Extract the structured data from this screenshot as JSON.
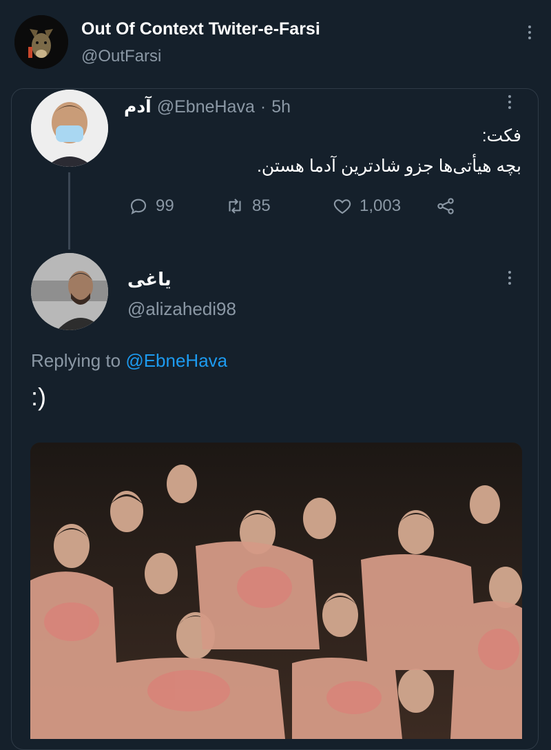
{
  "account": {
    "name": "Out Of Context Twiter-e-Farsi",
    "handle": "@OutFarsi"
  },
  "quoted": {
    "name": "آدم",
    "handle": "@EbneHava",
    "separator": "·",
    "time": "5h",
    "line1": "فکت:",
    "line2": "بچه هیأتی‌ها جزو شادترین آدما هستن.",
    "replies": "99",
    "retweets": "85",
    "likes": "1,003"
  },
  "reply": {
    "name": "یاغی",
    "handle": "@alizahedi98",
    "replying_prefix": "Replying to",
    "replying_to": "@EbneHava",
    "text": ":)"
  },
  "colors": {
    "background": "#15202b",
    "link": "#1d9bf0",
    "muted": "#8b98a5"
  },
  "icons": [
    "more-vertical-icon",
    "reply-icon",
    "retweet-icon",
    "like-icon",
    "share-icon"
  ]
}
